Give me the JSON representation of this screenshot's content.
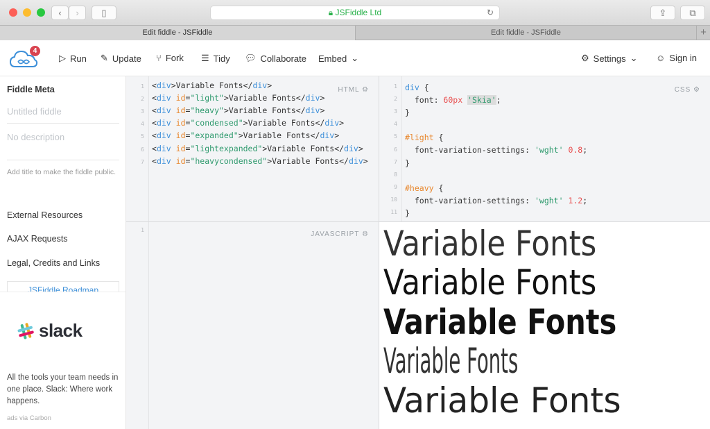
{
  "browser": {
    "url": "JSFiddle Ltd",
    "tabs": [
      "Edit fiddle - JSFiddle",
      "Edit fiddle - JSFiddle"
    ],
    "new_tab": "+"
  },
  "header": {
    "badge": "4",
    "run": "Run",
    "update": "Update",
    "fork": "Fork",
    "tidy": "Tidy",
    "collaborate": "Collaborate",
    "embed": "Embed",
    "settings": "Settings",
    "signin": "Sign in"
  },
  "sidebar": {
    "title": "Fiddle Meta",
    "title_placeholder": "Untitled fiddle",
    "desc_placeholder": "No description",
    "hint": "Add title to make the fiddle public.",
    "links": [
      "External Resources",
      "AJAX Requests",
      "Legal, Credits and Links"
    ],
    "roadmap": "JSFiddle Roadmap",
    "ad_brand": "slack",
    "ad_text": "All the tools your team needs in one place. Slack: Where work happens.",
    "ad_via": "ads via Carbon"
  },
  "html_panel": {
    "label": "HTML",
    "lines": [
      "1",
      "2",
      "3",
      "4",
      "5",
      "6",
      "7"
    ],
    "ids": [
      "",
      "light",
      "heavy",
      "condensed",
      "expanded",
      "lightexpanded",
      "heavycondensed"
    ],
    "text": "Variable Fonts"
  },
  "css_panel": {
    "label": "CSS",
    "lines": [
      "1",
      "2",
      "3",
      "4",
      "5",
      "6",
      "7",
      "8",
      "9",
      "10",
      "11"
    ],
    "code": {
      "sel1": "div",
      "prop1": "font",
      "val1": "60px",
      "font": "'Skia'",
      "sel2": "#light",
      "prop2": "font-variation-settings",
      "axis": "'wght'",
      "v2": "0.8",
      "sel3": "#heavy",
      "v3": "1.2"
    }
  },
  "js_panel": {
    "label": "JAVASCRIPT",
    "lines": [
      "1"
    ]
  },
  "result": {
    "lines": [
      "Variable Fonts",
      "Variable Fonts",
      "Variable Fonts",
      "Variable Fonts",
      "Variable Fonts"
    ]
  },
  "colors": {
    "accent": "#3c8fd9",
    "badge": "#d9434f",
    "secure": "#2bb24c"
  }
}
